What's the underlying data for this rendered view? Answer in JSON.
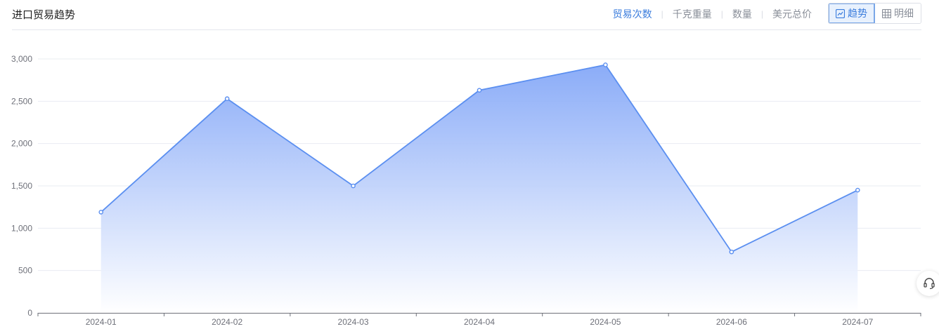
{
  "header": {
    "title": "进口贸易趋势",
    "metric_tabs": [
      "贸易次数",
      "千克重量",
      "数量",
      "美元总价"
    ],
    "active_metric": "贸易次数",
    "view_buttons": {
      "trend": "趋势",
      "detail": "明细"
    },
    "active_view": "趋势"
  },
  "icons": {
    "trend": "trend-chart-icon",
    "detail": "table-grid-icon",
    "support": "headset-icon"
  },
  "colors": {
    "accent": "#3b7ddd",
    "line": "#5b8ff0",
    "area_top": "#7ea3f7",
    "area_bottom": "#ffffff"
  },
  "chart_data": {
    "type": "area",
    "categories": [
      "2024-01",
      "2024-02",
      "2024-03",
      "2024-04",
      "2024-05",
      "2024-06",
      "2024-07"
    ],
    "values": [
      1190,
      2530,
      1500,
      2630,
      2930,
      720,
      1450
    ],
    "ylim": [
      0,
      3000
    ],
    "yticks": [
      0,
      500,
      1000,
      1500,
      2000,
      2500,
      3000
    ],
    "ytick_labels": [
      "0",
      "500",
      "1,000",
      "1,500",
      "2,000",
      "2,500",
      "3,000"
    ],
    "grid": true,
    "title": "",
    "xlabel": "",
    "ylabel": ""
  }
}
